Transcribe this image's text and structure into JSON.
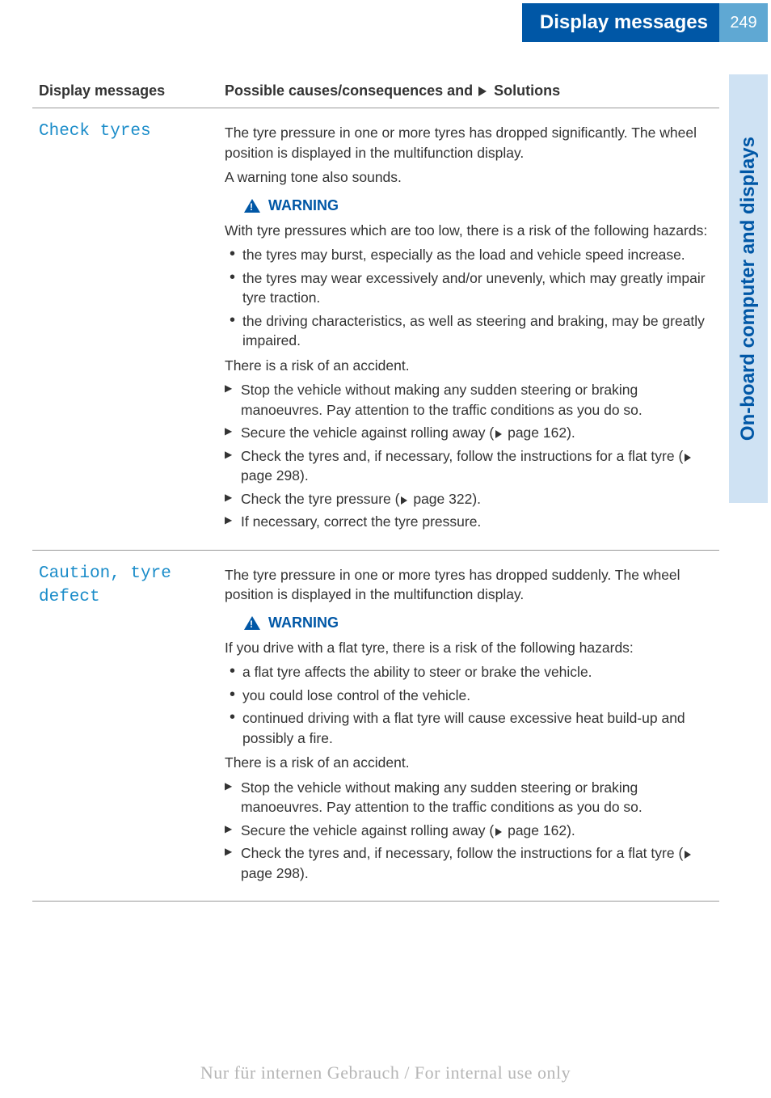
{
  "header": {
    "title": "Display messages",
    "page_number": "249"
  },
  "side_tab": "On-board computer and displays",
  "table": {
    "columns": {
      "left": "Display messages",
      "right_prefix": "Possible causes/consequences and ",
      "right_suffix": " Solutions"
    },
    "rows": [
      {
        "message": "Check tyres",
        "intro": [
          "The tyre pressure in one or more tyres has dropped significantly. The wheel position is displayed in the multifunction display.",
          "A warning tone also sounds."
        ],
        "warning_label": "WARNING",
        "warning_text": "With tyre pressures which are too low, there is a risk of the following hazards:",
        "bullets": [
          "the tyres may burst, especially as the load and vehicle speed increase.",
          "the tyres may wear excessively and/or unevenly, which may greatly impair tyre traction.",
          "the driving characteristics, as well as steering and braking, may be greatly impaired."
        ],
        "risk": "There is a risk of an accident.",
        "steps": [
          "Stop the vehicle without making any sudden steering or braking manoeuvres. Pay attention to the traffic conditions as you do so.",
          "Secure the vehicle against rolling away (▷ page 162).",
          "Check the tyres and, if necessary, follow the instructions for a flat tyre (▷ page 298).",
          "Check the tyre pressure (▷ page 322).",
          "If necessary, correct the tyre pressure."
        ]
      },
      {
        "message": "Caution, tyre defect",
        "intro": [
          "The tyre pressure in one or more tyres has dropped suddenly. The wheel position is displayed in the multifunction display."
        ],
        "warning_label": "WARNING",
        "warning_text": "If you drive with a flat tyre, there is a risk of the following hazards:",
        "bullets": [
          "a flat tyre affects the ability to steer or brake the vehicle.",
          "you could lose control of the vehicle.",
          "continued driving with a flat tyre will cause excessive heat build-up and possibly a fire."
        ],
        "risk": "There is a risk of an accident.",
        "steps": [
          "Stop the vehicle without making any sudden steering or braking manoeuvres. Pay attention to the traffic conditions as you do so.",
          "Secure the vehicle against rolling away (▷ page 162).",
          "Check the tyres and, if necessary, follow the instructions for a flat tyre (▷ page 298)."
        ]
      }
    ]
  },
  "footer": "Nur für internen Gebrauch / For internal use only"
}
